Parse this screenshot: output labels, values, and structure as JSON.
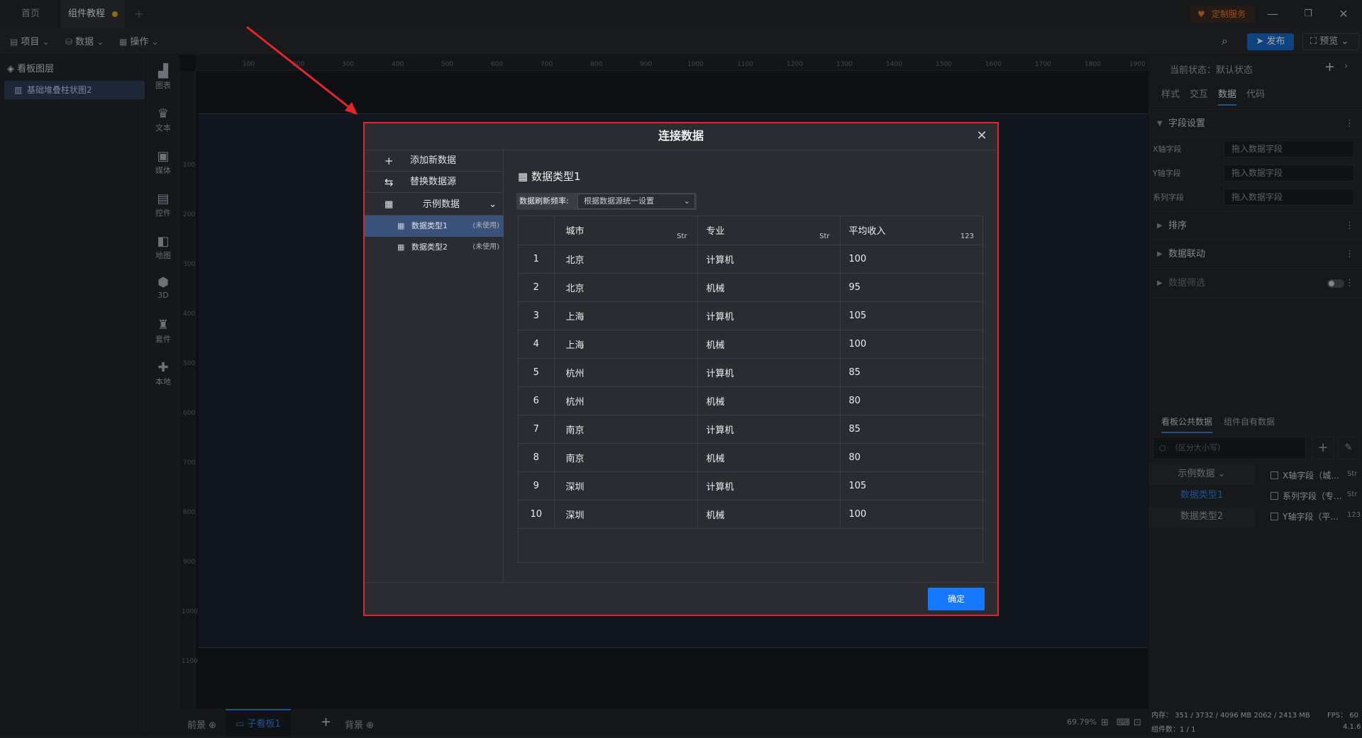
{
  "topbar": {
    "tabs": [
      {
        "label": "首页"
      },
      {
        "label": "组件教程"
      }
    ],
    "add_tab": "+",
    "custom_service": "定制服务"
  },
  "toolbar": {
    "menus": [
      {
        "label": "项目"
      },
      {
        "label": "数据"
      },
      {
        "label": "操作"
      }
    ],
    "publish": "发布",
    "preview": "预览"
  },
  "layers": {
    "title": "看板图层",
    "items": [
      {
        "label": "基础堆叠柱状图2"
      }
    ]
  },
  "components": [
    {
      "label": "图表"
    },
    {
      "label": "文本"
    },
    {
      "label": "媒体"
    },
    {
      "label": "控件"
    },
    {
      "label": "地图"
    },
    {
      "label": "3D"
    },
    {
      "label": "套件"
    },
    {
      "label": "本地"
    }
  ],
  "ruler": {
    "top": [
      "100",
      "200",
      "300",
      "400",
      "500",
      "600",
      "700",
      "800",
      "900",
      "1000",
      "1100",
      "1200",
      "1300",
      "1400",
      "1500",
      "1600",
      "1700",
      "1800",
      "1900"
    ],
    "left": [
      "100",
      "200",
      "300",
      "400",
      "500",
      "600",
      "700",
      "800",
      "900",
      "1000",
      "1100"
    ]
  },
  "bottombar": {
    "front": "前景",
    "sub_board": "子看板1",
    "add": "+",
    "background": "背景",
    "zoom": "69.79%"
  },
  "rightpanel": {
    "state_label": "当前状态：默认状态",
    "tabs": [
      {
        "label": "样式"
      },
      {
        "label": "交互"
      },
      {
        "label": "数据"
      },
      {
        "label": "代码"
      }
    ],
    "field_settings": "字段设置",
    "fields": [
      {
        "label": "X轴字段",
        "placeholder": "拖入数据字段"
      },
      {
        "label": "Y轴字段",
        "placeholder": "拖入数据字段"
      },
      {
        "label": "系列字段",
        "placeholder": "拖入数据字段"
      }
    ],
    "sections": [
      {
        "label": "排序"
      },
      {
        "label": "数据联动"
      },
      {
        "label": "数据筛选"
      }
    ],
    "data_tabs": [
      {
        "label": "看板公共数据"
      },
      {
        "label": "组件自有数据"
      }
    ],
    "search_placeholder": "（区分大小写）",
    "dataset_group": "示例数据",
    "datasets": [
      {
        "label": "数据类型1"
      },
      {
        "label": "数据类型2"
      }
    ],
    "dataset_fields": [
      {
        "label": "X轴字段（城...",
        "type": "Str"
      },
      {
        "label": "系列字段（专...",
        "type": "Str"
      },
      {
        "label": "Y轴字段（平...",
        "type": "123"
      }
    ],
    "status_mem": "内存： 351 / 3732 / 4096 MB  2062 / 2413 MB",
    "status_fps": "FPS： 60",
    "status_count": "组件数：1 / 1",
    "version": "4.1.6"
  },
  "modal": {
    "title": "连接数据",
    "left_menu": [
      {
        "label": "添加新数据"
      },
      {
        "label": "替换数据源"
      }
    ],
    "group": "示例数据",
    "group_items": [
      {
        "label": "数据类型1",
        "status": "(未使用)"
      },
      {
        "label": "数据类型2",
        "status": "(未使用)"
      }
    ],
    "data_title": "数据类型1",
    "refresh_label": "数据刷新频率:",
    "refresh_value": "根据数据源统一设置",
    "columns": [
      {
        "label": "城市",
        "type": "Str"
      },
      {
        "label": "专业",
        "type": "Str"
      },
      {
        "label": "平均收入",
        "type": "123"
      }
    ],
    "rows": [
      [
        "1",
        "北京",
        "计算机",
        "100"
      ],
      [
        "2",
        "北京",
        "机械",
        "95"
      ],
      [
        "3",
        "上海",
        "计算机",
        "105"
      ],
      [
        "4",
        "上海",
        "机械",
        "100"
      ],
      [
        "5",
        "杭州",
        "计算机",
        "85"
      ],
      [
        "6",
        "杭州",
        "机械",
        "80"
      ],
      [
        "7",
        "南京",
        "计算机",
        "85"
      ],
      [
        "8",
        "南京",
        "机械",
        "80"
      ],
      [
        "9",
        "深圳",
        "计算机",
        "105"
      ],
      [
        "10",
        "深圳",
        "机械",
        "100"
      ]
    ],
    "confirm": "确定"
  },
  "colors": {
    "accent": "#1677ff",
    "highlight_border": "#e0262d",
    "selected_item": "#3a527a"
  }
}
